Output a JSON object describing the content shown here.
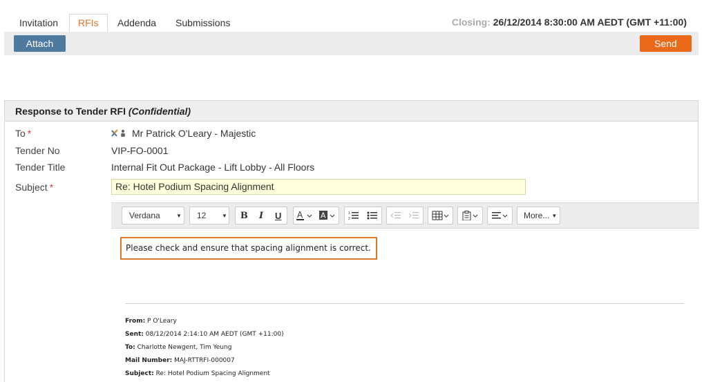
{
  "tabs": [
    {
      "label": "Invitation"
    },
    {
      "label": "RFIs"
    },
    {
      "label": "Addenda"
    },
    {
      "label": "Submissions"
    }
  ],
  "closing": {
    "label": "Closing:",
    "value": "26/12/2014 8:30:00 AM AEDT (GMT +11:00)"
  },
  "toolbar": {
    "attach_label": "Attach",
    "send_label": "Send"
  },
  "panel": {
    "title": "Response to Tender RFI",
    "title_suffix": "(Confidential)"
  },
  "form": {
    "to_label": "To",
    "to_value": "Mr Patrick O'Leary - Majestic",
    "tender_no_label": "Tender No",
    "tender_no_value": "VIP-FO-0001",
    "tender_title_label": "Tender Title",
    "tender_title_value": "Internal Fit Out Package - Lift Lobby - All Floors",
    "subject_label": "Subject",
    "subject_value": "Re: Hotel Podium Spacing Alignment",
    "required_mark": "*"
  },
  "editor": {
    "font": "Verdana",
    "size": "12",
    "bold": "B",
    "italic": "I",
    "underline": "U",
    "more_label": "More...",
    "body": "Please check and ensure that spacing alignment is correct."
  },
  "mail": {
    "from_label": "From:",
    "from_value": "P O'Leary",
    "sent_label": "Sent:",
    "sent_value": "08/12/2014 2:14:10 AM AEDT (GMT +11:00)",
    "to_label": "To:",
    "to_value": "Charlotte Newgent, Tim Yeung",
    "mail_no_label": "Mail Number:",
    "mail_no_value": "MAJ-RTTRFI-000007",
    "subject_label": "Subject:",
    "subject_value": "Re: Hotel Podium Spacing Alignment"
  },
  "colors": {
    "accent": "#e87722",
    "primary": "#4f7aa0",
    "send": "#ea6a1a",
    "required": "#d43b3b"
  }
}
